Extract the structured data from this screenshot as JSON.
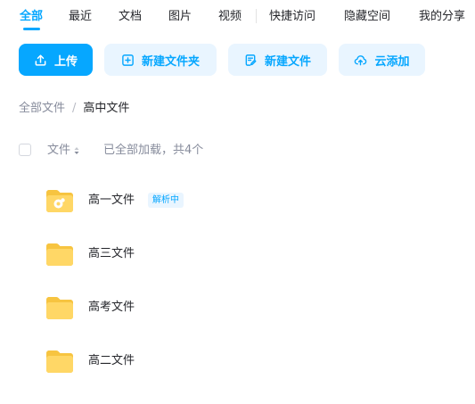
{
  "tabs": [
    {
      "label": "全部",
      "active": true
    },
    {
      "label": "最近"
    },
    {
      "label": "文档"
    },
    {
      "label": "图片"
    },
    {
      "label": "视频"
    },
    {
      "label": "快捷访问"
    },
    {
      "label": "隐藏空间"
    },
    {
      "label": "我的分享"
    }
  ],
  "toolbar": {
    "upload_label": "上传",
    "new_folder_label": "新建文件夹",
    "new_file_label": "新建文件",
    "cloud_add_label": "云添加"
  },
  "breadcrumb": {
    "root": "全部文件",
    "separator": "/",
    "current": "高中文件"
  },
  "list": {
    "column_label": "文件",
    "load_status": "已全部加载，共4个"
  },
  "files": [
    {
      "name": "高一文件",
      "badge": "解析中",
      "icon": "folder-with-badge-icon"
    },
    {
      "name": "高三文件",
      "icon": "folder-icon"
    },
    {
      "name": "高考文件",
      "icon": "folder-icon"
    },
    {
      "name": "高二文件",
      "icon": "folder-icon"
    }
  ],
  "colors": {
    "accent": "#06a7ff",
    "secondary_button_bg": "#e9f5ff",
    "folder": "#ffd766"
  }
}
